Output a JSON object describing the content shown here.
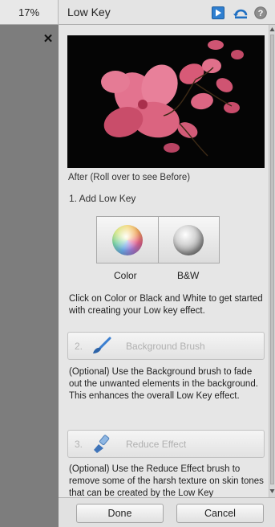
{
  "zoom": {
    "level": "17%"
  },
  "panel": {
    "title": "Low Key",
    "header_icons": [
      "play-video-icon",
      "back-icon",
      "help-icon"
    ]
  },
  "preview": {
    "caption": "After (Roll over to see Before)"
  },
  "step1": {
    "heading": "1. Add Low Key",
    "modes": [
      {
        "label": "Color",
        "icon": "color-sphere-icon"
      },
      {
        "label": "B&W",
        "icon": "bw-sphere-icon"
      }
    ],
    "description": "Click on Color or Black and White to get started with creating your Low key effect."
  },
  "step2": {
    "number": "2.",
    "label": "Background Brush",
    "icon": "brush-icon",
    "description": "(Optional) Use the Background brush to fade out the unwanted elements in the background. This enhances the overall Low Key effect."
  },
  "step3": {
    "number": "3.",
    "label": "Reduce Effect",
    "icon": "reduce-brush-icon",
    "description": "(Optional) Use the Reduce Effect brush to remove some of the harsh texture on skin tones that can be created by the Low Key"
  },
  "footer": {
    "done_label": "Done",
    "cancel_label": "Cancel"
  },
  "colors": {
    "panel_bg": "#e6e6e6",
    "canvas_gray": "#7d7d7d",
    "accent_blue": "#2f7fd0",
    "flower_pink": "#e0607e"
  }
}
